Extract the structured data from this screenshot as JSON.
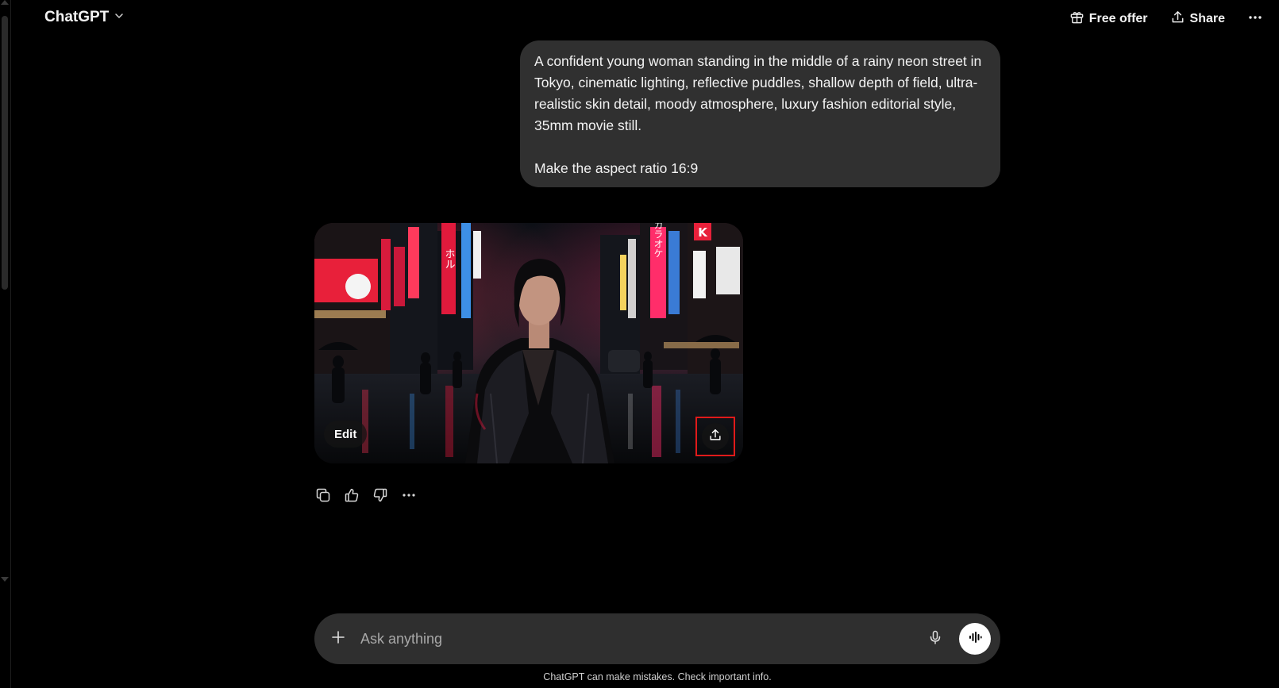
{
  "header": {
    "model_name": "ChatGPT",
    "model_chevron_icon": "chevron-down-icon",
    "free_offer_label": "Free offer",
    "free_offer_icon": "gift-icon",
    "share_label": "Share",
    "share_icon": "share-upload-icon",
    "more_icon": "more-horizontal-icon"
  },
  "conversation": {
    "user_message": {
      "paragraph_1": "A confident young woman standing in the middle of a rainy neon street in Tokyo, cinematic lighting, reflective puddles, shallow depth of field, ultra-realistic skin detail, moody atmosphere, luxury fashion editorial style, 35mm movie still.",
      "paragraph_2": "Make the aspect ratio 16:9"
    },
    "assistant_image": {
      "edit_label": "Edit",
      "share_icon": "share-upload-icon",
      "sign_text": [
        "カラオケ",
        "K",
        "ホル"
      ]
    },
    "message_actions": [
      {
        "name": "copy-icon"
      },
      {
        "name": "thumbs-up-icon"
      },
      {
        "name": "thumbs-down-icon"
      },
      {
        "name": "more-horizontal-icon"
      }
    ]
  },
  "composer": {
    "placeholder": "Ask anything",
    "plus_icon": "plus-icon",
    "mic_icon": "microphone-icon",
    "voice_icon": "voice-mode-icon"
  },
  "footer": {
    "disclaimer": "ChatGPT can make mistakes. Check important info."
  },
  "colors": {
    "background": "#000000",
    "bubble": "#303030",
    "composer": "#2f2f2f",
    "highlight_box": "#e01a1a",
    "neon_pink": "#ff2d6a",
    "neon_red": "#e8203a"
  }
}
